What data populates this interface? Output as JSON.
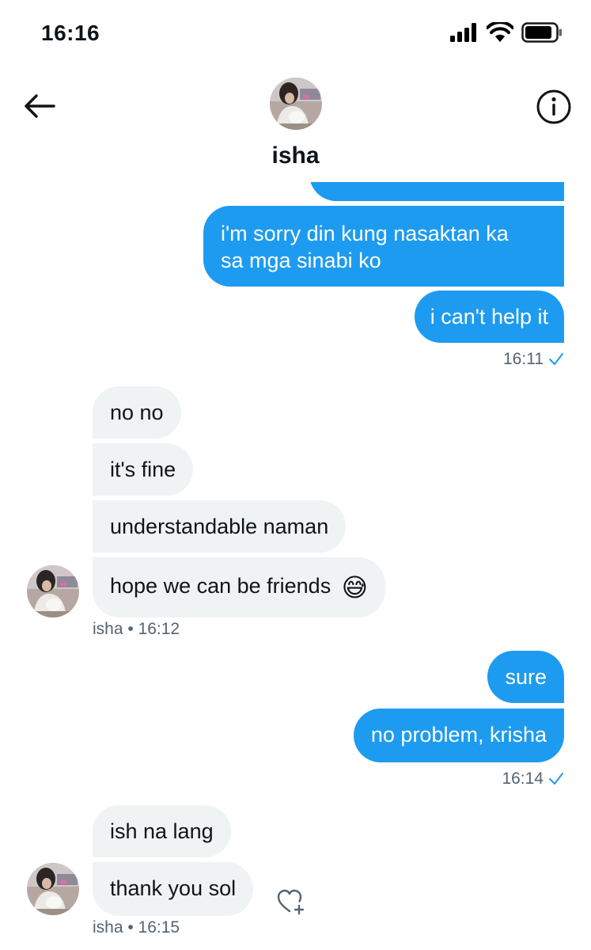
{
  "status_bar": {
    "time": "16:16"
  },
  "header": {
    "contact_name": "isha"
  },
  "messages": {
    "m1": {
      "text": "i'm sorry din kung nasaktan ka"
    },
    "m1b": {
      "text": "sa mga sinabi ko"
    },
    "m2": {
      "text": "i can't help it"
    },
    "m2_time": "16:11",
    "m3": {
      "text": "no no"
    },
    "m4": {
      "text": "it's fine"
    },
    "m5": {
      "text": "understandable naman"
    },
    "m6": {
      "text": "hope we can be friends",
      "emoji": "😅"
    },
    "m6_meta": "isha • 16:12",
    "m7": {
      "text": "sure"
    },
    "m8": {
      "text": "no problem, krisha"
    },
    "m8_time": "16:14",
    "m9": {
      "text": "ish na lang"
    },
    "m10": {
      "text": "thank you sol"
    },
    "m10_meta": "isha • 16:15"
  },
  "colors": {
    "outgoing": "#1d9bf0",
    "incoming": "#eff3f4",
    "meta": "#536471"
  },
  "icons": [
    "back-arrow-icon",
    "info-icon",
    "signal-icon",
    "wifi-icon",
    "battery-icon",
    "read-check-icon",
    "add-reaction-icon"
  ]
}
